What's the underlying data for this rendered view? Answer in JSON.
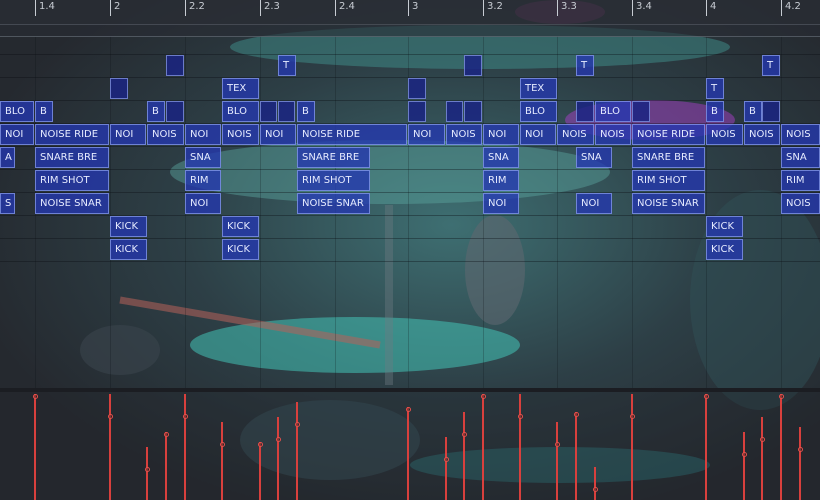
{
  "ruler": {
    "bars": [
      "1.4",
      "2",
      "2.2",
      "2.3",
      "2.4",
      "3",
      "3.2",
      "3.3",
      "3.4",
      "4",
      "4.2"
    ]
  },
  "colors": {
    "clip_blue": "#2437af",
    "automation_red": "#d8403d",
    "accent_teal": "#33c2b8",
    "accent_magenta": "#c03fd6"
  },
  "clips": {
    "row1": [
      "",
      "T",
      "",
      "T",
      "T"
    ],
    "row2": [
      "",
      "TEX",
      "",
      "TEX",
      "T"
    ],
    "row3": [
      "BLO",
      "B",
      "B",
      "",
      "BLO",
      "",
      "",
      "B",
      "",
      "",
      "",
      "BLO",
      "",
      "BLO",
      "",
      "B",
      "B",
      ""
    ],
    "row4": [
      "NOI",
      "NOISE RIDE",
      "NOI",
      "NOIS",
      "NOI",
      "NOIS",
      "NOI",
      "NOISE RIDE",
      "NOI",
      "NOIS",
      "NOI",
      "NOI",
      "NOIS",
      "NOIS",
      "NOISE RIDE",
      "NOIS",
      "NOIS",
      "NOIS"
    ],
    "row5": [
      "A",
      "SNARE BRE",
      "SNA",
      "SNARE BRE",
      "SNA",
      "SNA",
      "SNARE BRE",
      "SNA"
    ],
    "row6": [
      "RIM SHOT",
      "RIM",
      "RIM SHOT",
      "RIM",
      "RIM SHOT",
      "RIM"
    ],
    "row7": [
      "S",
      "NOISE SNAR",
      "NOI",
      "NOISE SNAR",
      "NOI",
      "NOI",
      "NOISE SNAR",
      "NOIS"
    ],
    "row8": [
      "KICK",
      "KICK",
      "KICK"
    ],
    "row9": [
      "KICK",
      "KICK",
      "KICK"
    ]
  }
}
